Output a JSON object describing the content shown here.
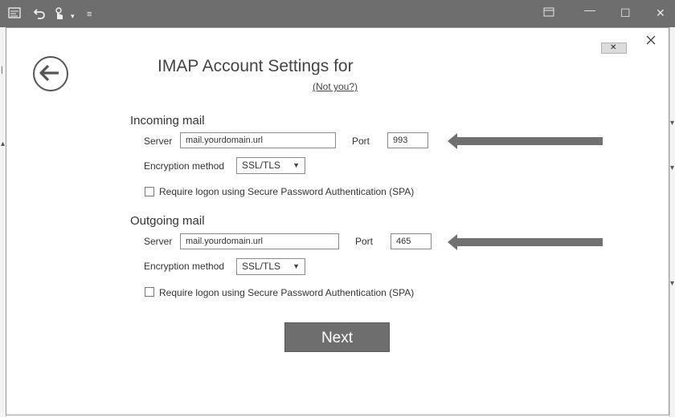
{
  "titlebar": {
    "icons": [
      "send-receive-icon",
      "undo-icon",
      "touch-mode-icon",
      "dropdown-icon",
      "customize-icon"
    ],
    "window_buttons": [
      "restore-ribbon-icon",
      "minimize-icon",
      "maximize-icon",
      "close-icon"
    ]
  },
  "dialog": {
    "title": "IMAP Account Settings for",
    "not_you": "(Not you?)",
    "next_label": "Next"
  },
  "incoming": {
    "heading": "Incoming mail",
    "server_label": "Server",
    "server_value": "mail.yourdomain.url",
    "port_label": "Port",
    "port_value": "993",
    "encryption_label": "Encryption method",
    "encryption_value": "SSL/TLS",
    "spa_label": "Require logon using Secure Password Authentication (SPA)",
    "spa_checked": false
  },
  "outgoing": {
    "heading": "Outgoing mail",
    "server_label": "Server",
    "server_value": "mail.yourdomain.url",
    "port_label": "Port",
    "port_value": "465",
    "encryption_label": "Encryption method",
    "encryption_value": "SSL/TLS",
    "spa_label": "Require logon using Secure Password Authentication (SPA)",
    "spa_checked": false
  },
  "colors": {
    "titlebar": "#6e6e6e",
    "button": "#6e6e6e",
    "arrow": "#707070"
  }
}
